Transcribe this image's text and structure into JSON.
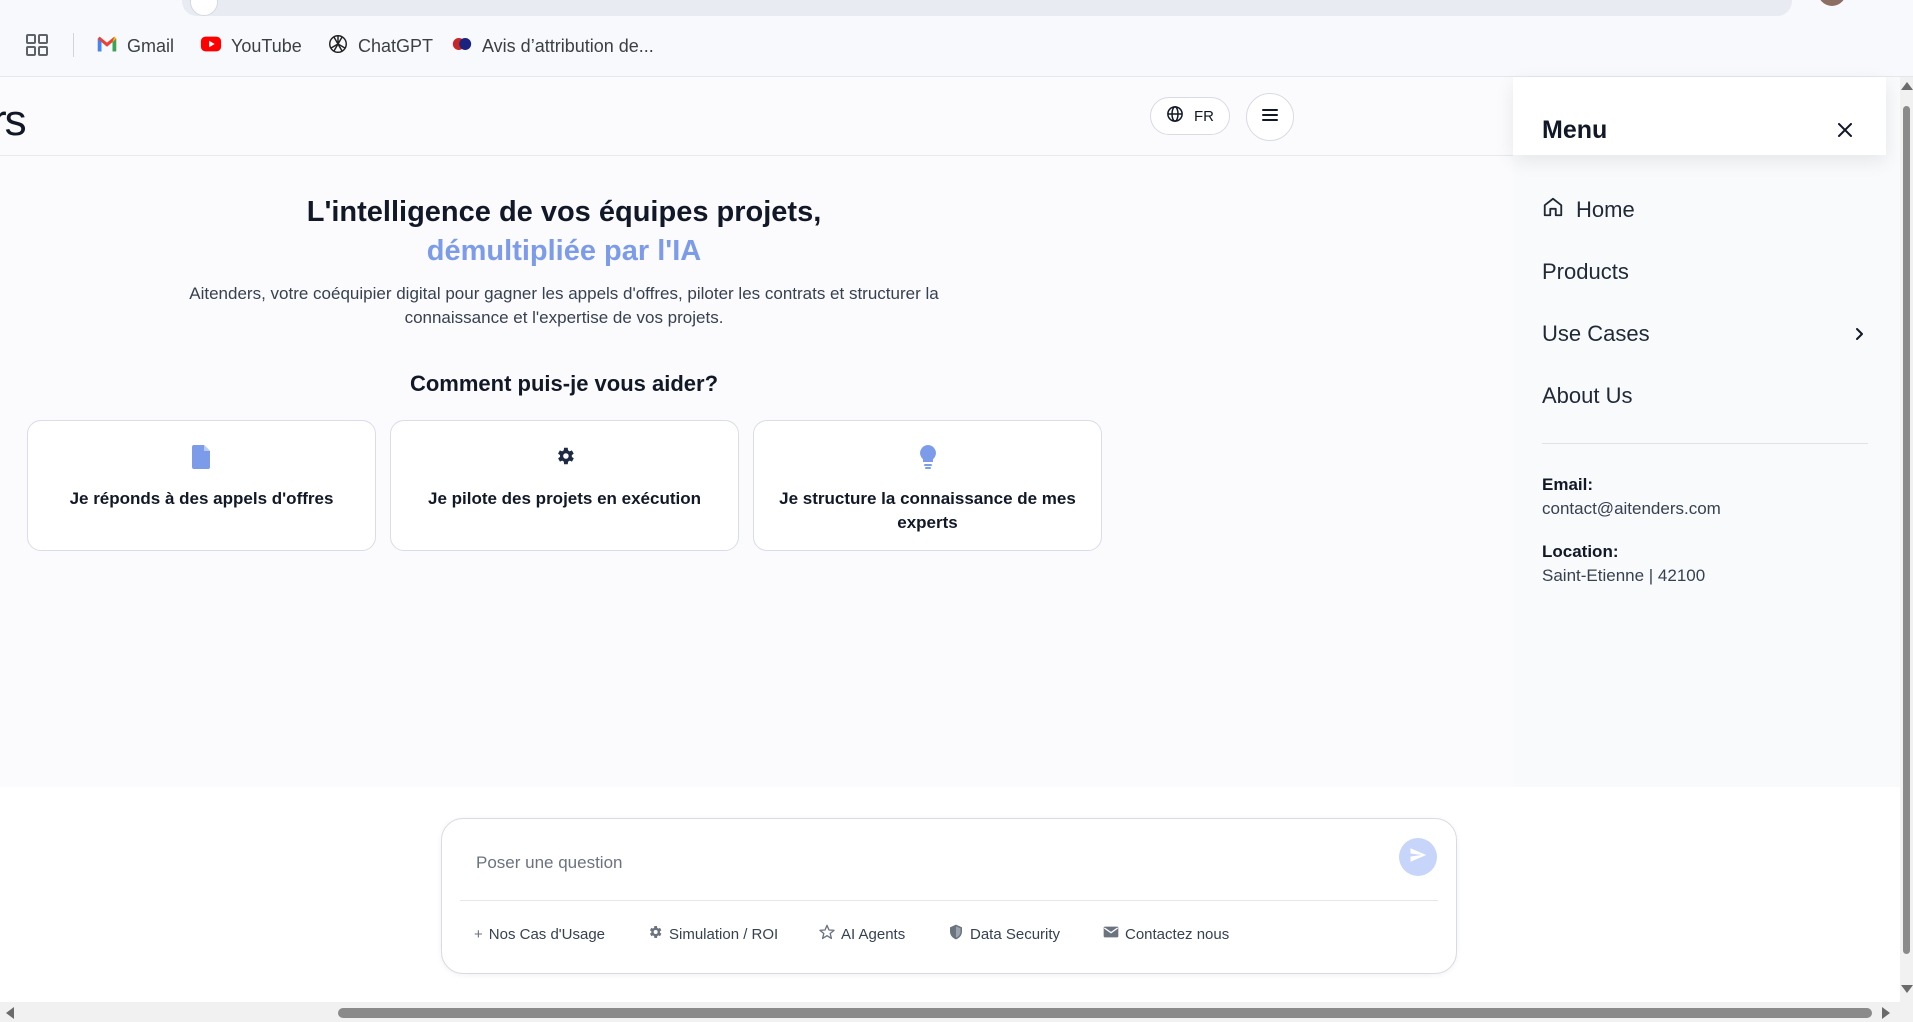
{
  "browser": {
    "bookmarks": [
      {
        "label": "Gmail",
        "icon": "gmail-icon"
      },
      {
        "label": "YouTube",
        "icon": "youtube-icon"
      },
      {
        "label": "ChatGPT",
        "icon": "chatgpt-icon"
      },
      {
        "label": "Avis d’attribution de...",
        "icon": "mastercard-icon"
      }
    ]
  },
  "header": {
    "logo_fragment": "rs",
    "lang_label": "FR",
    "lang_icon": "globe-icon",
    "menu_icon": "hamburger-icon"
  },
  "hero": {
    "title_line1": "L'intelligence de vos équipes projets,",
    "title_line2": "démultipliée par l'IA",
    "subtitle_line1": "Aitenders, votre coéquipier digital pour gagner les appels d'offres, piloter les contrats et structurer la",
    "subtitle_line2": "connaissance et l'expertise de vos projets.",
    "accent_color": "#7c9be8"
  },
  "help": {
    "title": "Comment puis-je vous aider?",
    "cards": [
      {
        "label": "Je réponds à des appels d'offres",
        "icon": "document-icon"
      },
      {
        "label": "Je pilote des projets en exécution",
        "icon": "gear-icon"
      },
      {
        "label": "Je structure la connaissance de mes experts",
        "icon": "lightbulb-icon"
      }
    ]
  },
  "chat": {
    "placeholder": "Poser une question",
    "chips": [
      {
        "label": "Nos Cas d'Usage",
        "icon": "plus-icon"
      },
      {
        "label": "Simulation / ROI",
        "icon": "gear-icon"
      },
      {
        "label": "AI Agents",
        "icon": "star-icon"
      },
      {
        "label": "Data Security",
        "icon": "shield-icon"
      },
      {
        "label": "Contactez nous",
        "icon": "mail-icon"
      }
    ]
  },
  "menu": {
    "title": "Menu",
    "items": [
      {
        "label": "Home",
        "icon": "home-icon"
      },
      {
        "label": "Products"
      },
      {
        "label": "Use Cases",
        "icon": "chevron-right-icon"
      },
      {
        "label": "About Us"
      }
    ],
    "email_label": "Email:",
    "email_value": "contact@aitenders.com",
    "location_label": "Location:",
    "location_value": "Saint-Etienne | 42100"
  }
}
